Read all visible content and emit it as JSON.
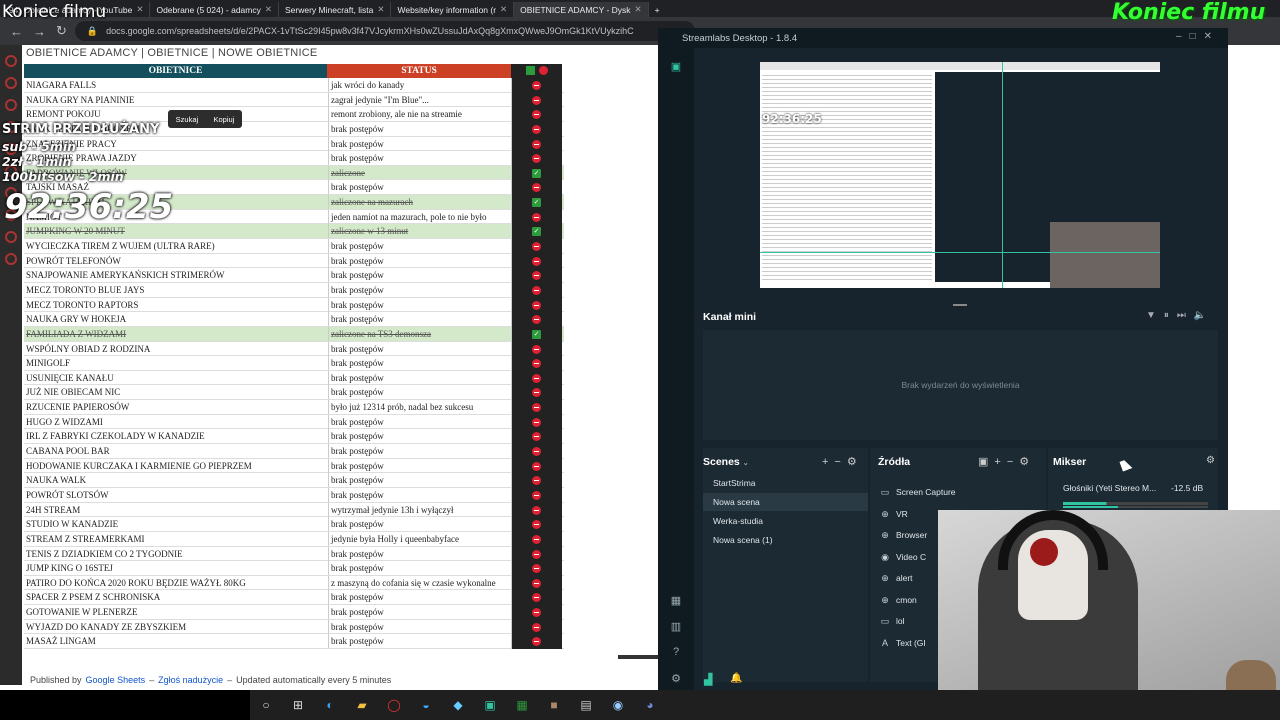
{
  "overlay": {
    "top_left": "Koniec filmu",
    "top_right": "Koniec filmu",
    "strim": "STRIM PRZEDŁUŻANY",
    "subs": [
      "sub - 5min",
      "2zł - 1min",
      "100bitsów - 2min"
    ],
    "timer": "92:36:25"
  },
  "browser": {
    "tabs": [
      {
        "label": "(94) Obietnice adamcy - YouTube",
        "active": false
      },
      {
        "label": "Odebrane (5 024) - adamcy",
        "active": false
      },
      {
        "label": "Serwery Minecraft, lista",
        "active": false
      },
      {
        "label": "Website/key information (r",
        "active": false
      },
      {
        "label": "OBIETNICE ADAMCY - Dysk",
        "active": true
      }
    ],
    "new_tab": "+",
    "url": "docs.google.com/spreadsheets/d/e/2PACX-1vTtSc29I45pw8v3f47VJcykrmXHs0wZUssuJdAxQq8gXmxQWweJ9OmGk1KtVUykzihC"
  },
  "sheet": {
    "breadcrumb": "OBIETNICE ADAMCY | OBIETNICE | NOWE OBIETNICE",
    "col_obietnice": "OBIETNICE",
    "col_status": "STATUS",
    "context_menu": {
      "search": "Szukaj",
      "copy": "Kopiuj"
    },
    "rows": [
      {
        "name": "NIAGARA FALLS",
        "status": "jak wróci do kanady",
        "done": false
      },
      {
        "name": "NAUKA GRY NA PIANINIE",
        "status": "zagrał jedynie \"I'm Blue\"...",
        "done": false
      },
      {
        "name": "REMONT POKOJU",
        "status": "remont zrobiony, ale nie na streamie",
        "done": false
      },
      {
        "name": "SKOK ZE SPADOCHRONEM",
        "status": "brak postępów",
        "done": false
      },
      {
        "name": "ZNALEZIENIE PRACY",
        "status": "brak postępów",
        "done": false
      },
      {
        "name": "ZROBIENIE PRAWA JAZDY",
        "status": "brak postępów",
        "done": false
      },
      {
        "name": "FARBOWANIE WŁOSÓW",
        "status": "zaliczone",
        "done": true
      },
      {
        "name": "TAJSKI MASAŻ",
        "status": "brak postępów",
        "done": false
      },
      {
        "name": "SPŁYW KAJAKIEM",
        "status": "zaliczone na mazurach",
        "done": true
      },
      {
        "name": "NAMIOT",
        "status": "jeden namiot na mazurach, pole to nie było",
        "done": false
      },
      {
        "name": "JUMPKING W 20 MINUT",
        "status": "zaliczone w 13 minut",
        "done": true
      },
      {
        "name": "WYCIECZKA TIREM Z WUJEM (ULTRA RARE)",
        "status": "brak postępów",
        "done": false
      },
      {
        "name": "POWRÓT TELEFONÓW",
        "status": "brak postępów",
        "done": false
      },
      {
        "name": "SNAJPOWANIE AMERYKAŃSKICH STRIMERÓW",
        "status": "brak postępów",
        "done": false
      },
      {
        "name": "MECZ TORONTO BLUE JAYS",
        "status": "brak postępów",
        "done": false
      },
      {
        "name": "MECZ TORONTO RAPTORS",
        "status": "brak postępów",
        "done": false
      },
      {
        "name": "NAUKA GRY W HOKEJA",
        "status": "brak postępów",
        "done": false
      },
      {
        "name": "FAMILIADA Z WIDZAMI",
        "status": "zaliczone na TS3 demonsza",
        "done": true
      },
      {
        "name": "WSPÓLNY OBIAD Z RODZINA",
        "status": "brak postępów",
        "done": false
      },
      {
        "name": "MINIGOLF",
        "status": "brak postępów",
        "done": false
      },
      {
        "name": "USUNIĘCIE KANAŁU",
        "status": "brak postępów",
        "done": false
      },
      {
        "name": "JUŻ NIE OBIECAM NIC",
        "status": "brak postępów",
        "done": false
      },
      {
        "name": "RZUCENIE PAPIEROSÓW",
        "status": "było już 12314 prób, nadal bez sukcesu",
        "done": false
      },
      {
        "name": "HUGO Z WIDZAMI",
        "status": "brak postępów",
        "done": false
      },
      {
        "name": "IRL Z FABRYKI CZEKOLADY W KANADZIE",
        "status": "brak postępów",
        "done": false
      },
      {
        "name": "CABANA POOL BAR",
        "status": "brak postępów",
        "done": false
      },
      {
        "name": "HODOWANIE KURCZAKA I KARMIENIE GO PIEPRZEM",
        "status": "brak postępów",
        "done": false
      },
      {
        "name": "NAUKA WALK",
        "status": "brak postępów",
        "done": false
      },
      {
        "name": "POWRÓT SLOTSÓW",
        "status": "brak postępów",
        "done": false
      },
      {
        "name": "24H STREAM",
        "status": "wytrzymał jedynie 13h i wyłączył",
        "done": false
      },
      {
        "name": "STUDIO W KANADZIE",
        "status": "brak postępów",
        "done": false
      },
      {
        "name": "STREAM Z STREAMERKAMI",
        "status": "jedynie była Holly i queenbabyface",
        "done": false
      },
      {
        "name": "TENIS Z DZIADKIEM CO 2 TYGODNIE",
        "status": "brak postępów",
        "done": false
      },
      {
        "name": "JUMP KING O 16STEJ",
        "status": "brak postępów",
        "done": false
      },
      {
        "name": "PATIRO DO KOŃCA 2020 ROKU BĘDZIE WAŻYŁ 80KG",
        "status": "z maszyną do cofania się w czasie wykonalne",
        "done": false
      },
      {
        "name": "SPACER Z PSEM Z SCHRONISKA",
        "status": "brak postępów",
        "done": false
      },
      {
        "name": "GOTOWANIE W PLENERZE",
        "status": "brak postępów",
        "done": false
      },
      {
        "name": "WYJAZD DO KANADY ZE ZBYSZKIEM",
        "status": "brak postępów",
        "done": false
      },
      {
        "name": "MASAŻ LINGAM",
        "status": "brak postępów",
        "done": false
      }
    ],
    "footer": {
      "published": "Published by",
      "sheets": "Google Sheets",
      "dash": "–",
      "report": "Zgłoś nadużycie",
      "updated": "Updated automatically every 5 minutes"
    }
  },
  "streamlabs": {
    "title": "Streamlabs Desktop - 1.8.4",
    "mini_time": "92:36:25",
    "kanal_mini": "Kanał mini",
    "empty_events": "Brak wydarzeń do wyświetlenia",
    "scenes_label": "Scenes",
    "scenes": [
      "StartStrima",
      "Nowa scena",
      "Werka-studia",
      "Nowa scena (1)"
    ],
    "selected_scene": "Nowa scena",
    "sources_label": "Źródła",
    "sources": [
      {
        "label": "Screen Capture",
        "icon": "monitor-icon"
      },
      {
        "label": "VR",
        "icon": "globe-icon"
      },
      {
        "label": "Browser",
        "icon": "globe-icon"
      },
      {
        "label": "Video C",
        "icon": "camera-icon"
      },
      {
        "label": "alert",
        "icon": "globe-icon"
      },
      {
        "label": "cmon",
        "icon": "globe-icon"
      },
      {
        "label": "lol",
        "icon": "monitor-icon"
      },
      {
        "label": "Text (GI",
        "icon": "text-icon"
      }
    ],
    "mixer_label": "Mikser",
    "mixer_device": "Głośniki (Yeti Stereo M...",
    "mixer_db": "-12.5 dB"
  },
  "colors": {
    "header_obietnice": "#134f5c",
    "header_status": "#cc4125",
    "streamlabs_bg": "#17242d",
    "accent": "#31c3a2",
    "koniec_right": "#33ff33"
  }
}
